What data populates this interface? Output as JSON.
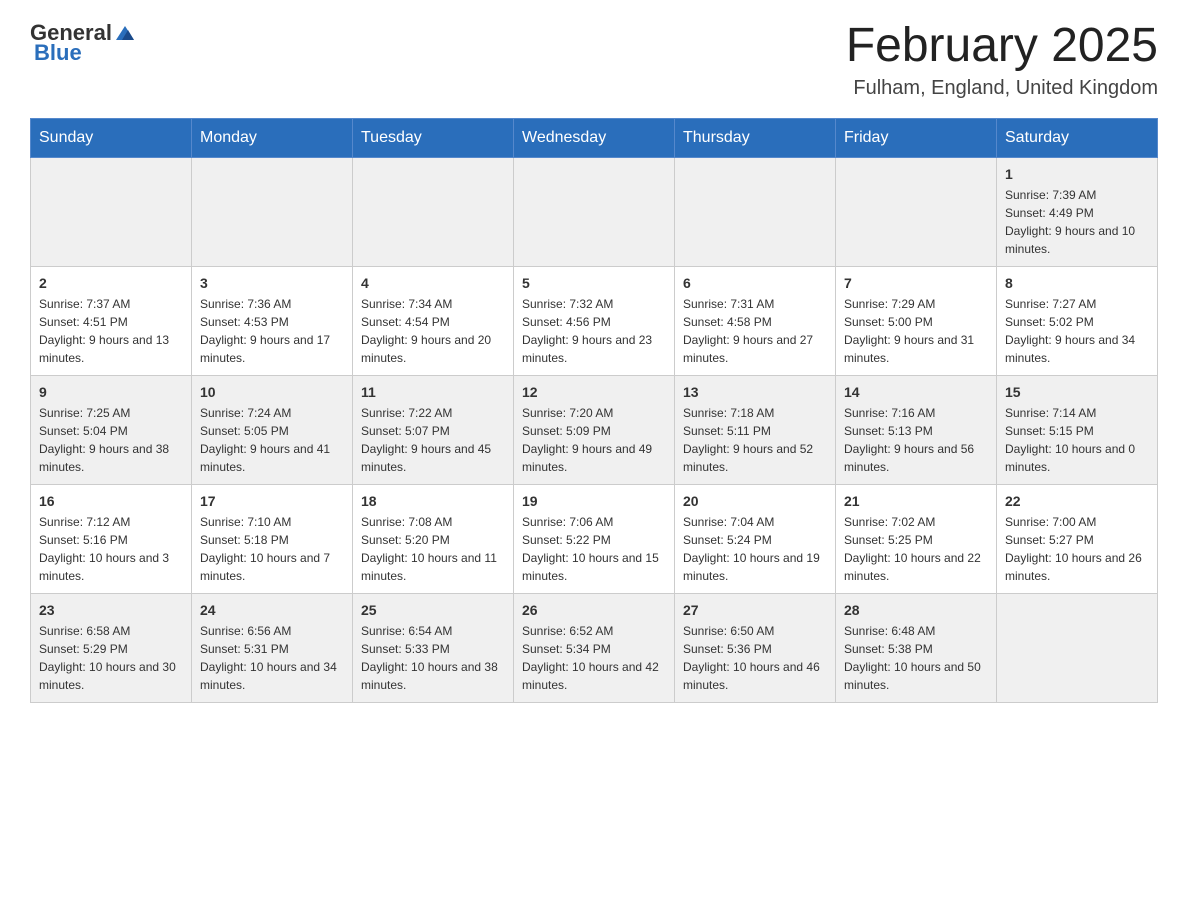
{
  "logo": {
    "text_general": "General",
    "text_blue": "Blue"
  },
  "header": {
    "month_year": "February 2025",
    "location": "Fulham, England, United Kingdom"
  },
  "days_of_week": [
    "Sunday",
    "Monday",
    "Tuesday",
    "Wednesday",
    "Thursday",
    "Friday",
    "Saturday"
  ],
  "weeks": [
    [
      {
        "day": "",
        "info": ""
      },
      {
        "day": "",
        "info": ""
      },
      {
        "day": "",
        "info": ""
      },
      {
        "day": "",
        "info": ""
      },
      {
        "day": "",
        "info": ""
      },
      {
        "day": "",
        "info": ""
      },
      {
        "day": "1",
        "info": "Sunrise: 7:39 AM\nSunset: 4:49 PM\nDaylight: 9 hours and 10 minutes."
      }
    ],
    [
      {
        "day": "2",
        "info": "Sunrise: 7:37 AM\nSunset: 4:51 PM\nDaylight: 9 hours and 13 minutes."
      },
      {
        "day": "3",
        "info": "Sunrise: 7:36 AM\nSunset: 4:53 PM\nDaylight: 9 hours and 17 minutes."
      },
      {
        "day": "4",
        "info": "Sunrise: 7:34 AM\nSunset: 4:54 PM\nDaylight: 9 hours and 20 minutes."
      },
      {
        "day": "5",
        "info": "Sunrise: 7:32 AM\nSunset: 4:56 PM\nDaylight: 9 hours and 23 minutes."
      },
      {
        "day": "6",
        "info": "Sunrise: 7:31 AM\nSunset: 4:58 PM\nDaylight: 9 hours and 27 minutes."
      },
      {
        "day": "7",
        "info": "Sunrise: 7:29 AM\nSunset: 5:00 PM\nDaylight: 9 hours and 31 minutes."
      },
      {
        "day": "8",
        "info": "Sunrise: 7:27 AM\nSunset: 5:02 PM\nDaylight: 9 hours and 34 minutes."
      }
    ],
    [
      {
        "day": "9",
        "info": "Sunrise: 7:25 AM\nSunset: 5:04 PM\nDaylight: 9 hours and 38 minutes."
      },
      {
        "day": "10",
        "info": "Sunrise: 7:24 AM\nSunset: 5:05 PM\nDaylight: 9 hours and 41 minutes."
      },
      {
        "day": "11",
        "info": "Sunrise: 7:22 AM\nSunset: 5:07 PM\nDaylight: 9 hours and 45 minutes."
      },
      {
        "day": "12",
        "info": "Sunrise: 7:20 AM\nSunset: 5:09 PM\nDaylight: 9 hours and 49 minutes."
      },
      {
        "day": "13",
        "info": "Sunrise: 7:18 AM\nSunset: 5:11 PM\nDaylight: 9 hours and 52 minutes."
      },
      {
        "day": "14",
        "info": "Sunrise: 7:16 AM\nSunset: 5:13 PM\nDaylight: 9 hours and 56 minutes."
      },
      {
        "day": "15",
        "info": "Sunrise: 7:14 AM\nSunset: 5:15 PM\nDaylight: 10 hours and 0 minutes."
      }
    ],
    [
      {
        "day": "16",
        "info": "Sunrise: 7:12 AM\nSunset: 5:16 PM\nDaylight: 10 hours and 3 minutes."
      },
      {
        "day": "17",
        "info": "Sunrise: 7:10 AM\nSunset: 5:18 PM\nDaylight: 10 hours and 7 minutes."
      },
      {
        "day": "18",
        "info": "Sunrise: 7:08 AM\nSunset: 5:20 PM\nDaylight: 10 hours and 11 minutes."
      },
      {
        "day": "19",
        "info": "Sunrise: 7:06 AM\nSunset: 5:22 PM\nDaylight: 10 hours and 15 minutes."
      },
      {
        "day": "20",
        "info": "Sunrise: 7:04 AM\nSunset: 5:24 PM\nDaylight: 10 hours and 19 minutes."
      },
      {
        "day": "21",
        "info": "Sunrise: 7:02 AM\nSunset: 5:25 PM\nDaylight: 10 hours and 22 minutes."
      },
      {
        "day": "22",
        "info": "Sunrise: 7:00 AM\nSunset: 5:27 PM\nDaylight: 10 hours and 26 minutes."
      }
    ],
    [
      {
        "day": "23",
        "info": "Sunrise: 6:58 AM\nSunset: 5:29 PM\nDaylight: 10 hours and 30 minutes."
      },
      {
        "day": "24",
        "info": "Sunrise: 6:56 AM\nSunset: 5:31 PM\nDaylight: 10 hours and 34 minutes."
      },
      {
        "day": "25",
        "info": "Sunrise: 6:54 AM\nSunset: 5:33 PM\nDaylight: 10 hours and 38 minutes."
      },
      {
        "day": "26",
        "info": "Sunrise: 6:52 AM\nSunset: 5:34 PM\nDaylight: 10 hours and 42 minutes."
      },
      {
        "day": "27",
        "info": "Sunrise: 6:50 AM\nSunset: 5:36 PM\nDaylight: 10 hours and 46 minutes."
      },
      {
        "day": "28",
        "info": "Sunrise: 6:48 AM\nSunset: 5:38 PM\nDaylight: 10 hours and 50 minutes."
      },
      {
        "day": "",
        "info": ""
      }
    ]
  ]
}
